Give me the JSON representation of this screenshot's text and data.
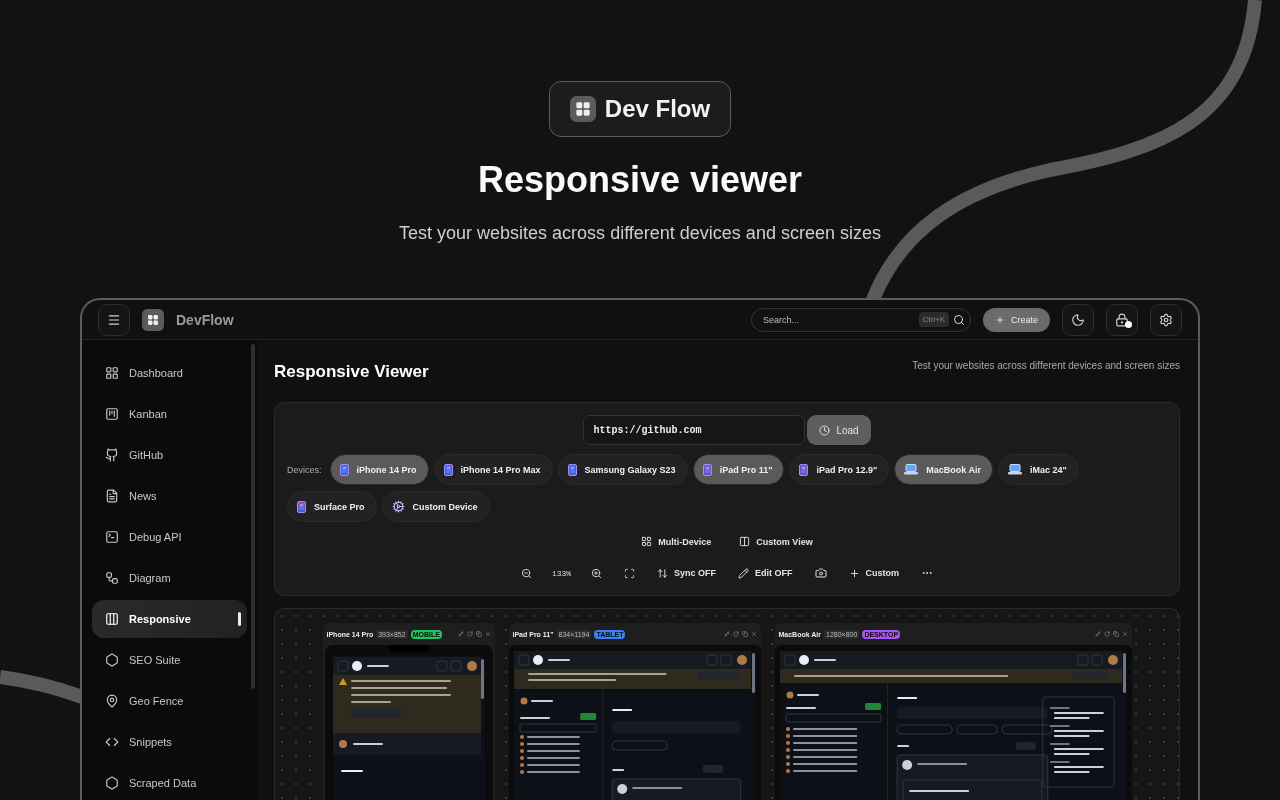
{
  "hero": {
    "brand": "Dev Flow",
    "title": "Responsive viewer",
    "subtitle": "Test your websites across different devices and screen sizes"
  },
  "topbar": {
    "brand": "DevFlow",
    "search": {
      "placeholder": "Search...",
      "shortcut": "Ctrl+K"
    },
    "create": "Create",
    "notification": true
  },
  "sidebar": [
    {
      "label": "Dashboard",
      "selected": false
    },
    {
      "label": "Kanban",
      "selected": false
    },
    {
      "label": "GitHub",
      "selected": false
    },
    {
      "label": "News",
      "selected": false
    },
    {
      "label": "Debug API",
      "selected": false
    },
    {
      "label": "Diagram",
      "selected": false
    },
    {
      "label": "Responsive",
      "selected": true
    },
    {
      "label": "SEO Suite",
      "selected": false
    },
    {
      "label": "Geo Fence",
      "selected": false
    },
    {
      "label": "Snippets",
      "selected": false
    },
    {
      "label": "Scraped Data",
      "selected": false
    }
  ],
  "page": {
    "title": "Responsive Viewer",
    "subtitle": "Test your websites across different devices and screen sizes"
  },
  "url": {
    "value": "https://github.com",
    "button": "Load"
  },
  "devices_label": "Devices:",
  "devices": [
    {
      "name": "iPhone 14 Pro",
      "kind": "phone",
      "selected": true
    },
    {
      "name": "iPhone 14 Pro Max",
      "kind": "phone",
      "selected": false
    },
    {
      "name": "Samsung Galaxy S23",
      "kind": "phone",
      "selected": false
    },
    {
      "name": "iPad Pro 11\"",
      "kind": "phone",
      "selected": true
    },
    {
      "name": "iPad Pro 12.9\"",
      "kind": "phone",
      "selected": false
    },
    {
      "name": "MacBook Air",
      "kind": "laptop",
      "selected": true
    },
    {
      "name": "iMac 24\"",
      "kind": "laptop",
      "selected": false
    },
    {
      "name": "Surface Pro",
      "kind": "phone",
      "selected": false
    },
    {
      "name": "Custom Device",
      "kind": "custom",
      "selected": false
    }
  ],
  "modes": [
    {
      "label": "Multi-Device",
      "kind": "grid"
    },
    {
      "label": "Custom View",
      "kind": "columns"
    }
  ],
  "toolbar": [
    {
      "kind": "zoom-out"
    },
    {
      "kind": "zoom-level",
      "label": "133%"
    },
    {
      "kind": "zoom-in"
    },
    {
      "kind": "fit"
    },
    {
      "kind": "sync",
      "label": "Sync OFF"
    },
    {
      "kind": "edit",
      "label": "Edit OFF"
    },
    {
      "kind": "screenshot"
    },
    {
      "kind": "custom",
      "label": "Custom"
    },
    {
      "kind": "more"
    }
  ],
  "previews": [
    {
      "name": "iPhone 14 Pro",
      "resolution": "393×852",
      "badge": "MOBILE",
      "color": "#22c55e",
      "kind": "mobile"
    },
    {
      "name": "iPad Pro 11\"",
      "resolution": "834×1194",
      "badge": "TABLET",
      "color": "#3b82f6",
      "kind": "tablet"
    },
    {
      "name": "MacBook Air",
      "resolution": "1280×800",
      "badge": "DESKTOP",
      "color": "#a855f7",
      "kind": "desktop"
    }
  ]
}
